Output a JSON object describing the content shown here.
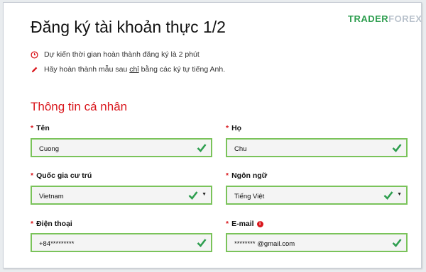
{
  "page": {
    "title": "Đăng ký tài khoản thực 1/2",
    "logo_part1": "TRADER",
    "logo_part2": "FOREX"
  },
  "notes": [
    {
      "icon": "clock-icon",
      "text": "Dự kiến thời gian hoàn thành đăng ký là 2 phút"
    },
    {
      "icon": "pencil-icon",
      "text_before": "Hãy hoàn thành mẫu sau ",
      "text_underlined": "chỉ",
      "text_after": " bằng các ký tự tiếng Anh."
    }
  ],
  "section_title": "Thông tin cá nhân",
  "required_mark": "*",
  "fields": {
    "first_name": {
      "label": "Tên",
      "value": "Cuong"
    },
    "last_name": {
      "label": "Họ",
      "value": "Chu"
    },
    "country": {
      "label": "Quốc gia cư trú",
      "value": "Vietnam"
    },
    "language": {
      "label": "Ngôn ngữ",
      "value": "Tiếng Việt"
    },
    "phone": {
      "label": "Điện thoại",
      "value": "+84*********"
    },
    "email": {
      "label": "E-mail",
      "value": "********  @gmail.com",
      "info_icon": "info-icon"
    }
  },
  "colors": {
    "accent_red": "#d9161c",
    "valid_green": "#7ac35a",
    "check_green": "#2e9e4f"
  }
}
